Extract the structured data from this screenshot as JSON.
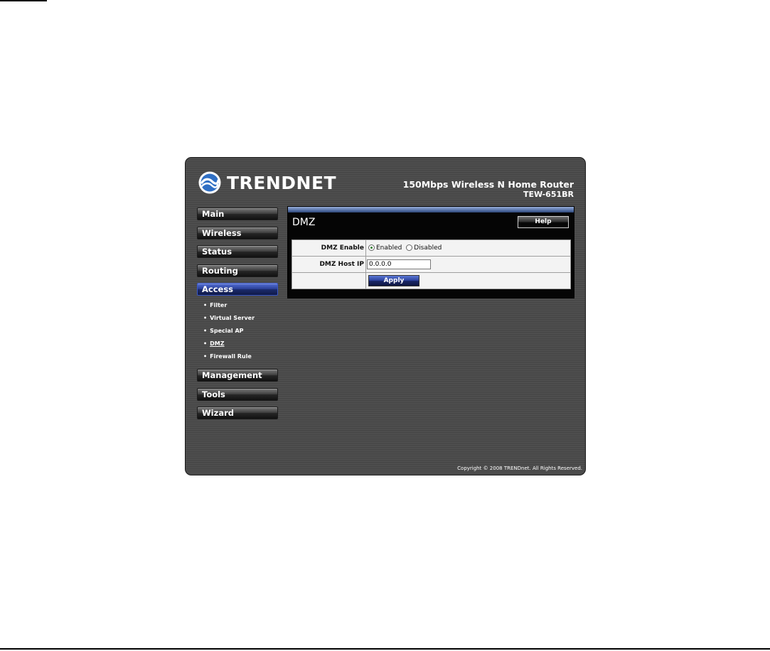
{
  "header": {
    "brand": "TRENDNET",
    "product": "150Mbps Wireless N Home Router",
    "model": "TEW-651BR"
  },
  "nav": {
    "main": "Main",
    "wireless": "Wireless",
    "status": "Status",
    "routing": "Routing",
    "access": "Access",
    "access_sub": [
      "Filter",
      "Virtual Server",
      "Special AP",
      "DMZ",
      "Firewall Rule"
    ],
    "management": "Management",
    "tools": "Tools",
    "wizard": "Wizard",
    "bullet": "•"
  },
  "content": {
    "title": "DMZ",
    "help": "Help",
    "dmz_enable_label": "DMZ Enable",
    "option_enabled": "Enabled",
    "option_disabled": "Disabled",
    "selected_option": "Enabled",
    "dmz_host_ip_label": "DMZ Host IP",
    "dmz_host_ip_value": "0.0.0.0",
    "apply": "Apply"
  },
  "footer": {
    "copyright": "Copyright © 2008 TRENDnet. All Rights Reserved."
  },
  "colors": {
    "frame_bg": "#4a4a4a",
    "active_nav": "#2a3f96",
    "content_bar": "#5c78ad"
  }
}
